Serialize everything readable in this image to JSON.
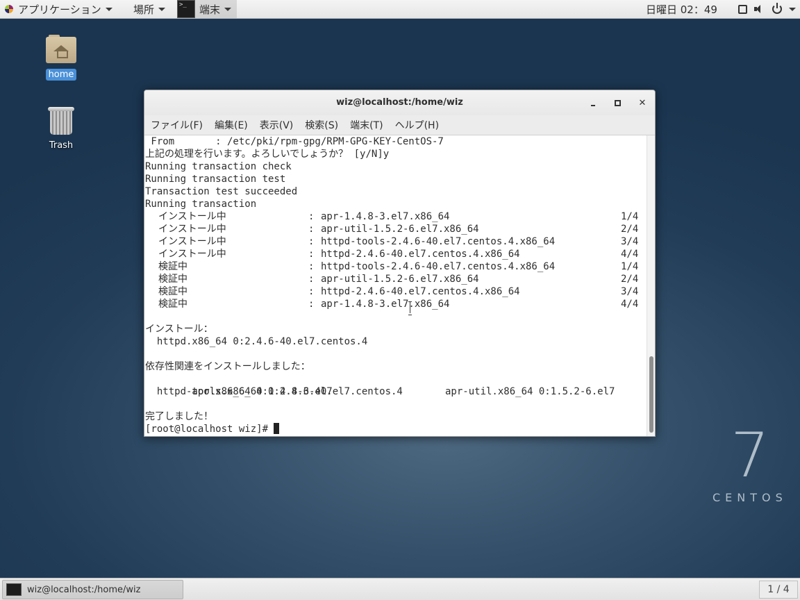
{
  "top_panel": {
    "applications": "アプリケーション",
    "places": "場所",
    "active_app": "端末",
    "clock": "日曜日 02：49"
  },
  "desktop": {
    "icons": [
      {
        "label": "home",
        "icon": "home-folder-icon"
      },
      {
        "label": "Trash",
        "icon": "trash-icon"
      }
    ]
  },
  "window": {
    "title": "wiz@localhost:/home/wiz",
    "menu": [
      "ファイル(F)",
      "編集(E)",
      "表示(V)",
      "検索(S)",
      "端末(T)",
      "ヘルプ(H)"
    ],
    "terminal": {
      "header_lines": [
        " From       : /etc/pki/rpm-gpg/RPM-GPG-KEY-CentOS-7",
        "上記の処理を行います。よろしいでしょうか？ [y/N]y",
        "Running transaction check",
        "Running transaction test",
        "Transaction test succeeded",
        "Running transaction"
      ],
      "progress_rows": [
        {
          "action": "インストール中",
          "package": "apr-1.4.8-3.el7.x86_64",
          "count": "1/4"
        },
        {
          "action": "インストール中",
          "package": "apr-util-1.5.2-6.el7.x86_64",
          "count": "2/4"
        },
        {
          "action": "インストール中",
          "package": "httpd-tools-2.4.6-40.el7.centos.4.x86_64",
          "count": "3/4"
        },
        {
          "action": "インストール中",
          "package": "httpd-2.4.6-40.el7.centos.4.x86_64",
          "count": "4/4"
        },
        {
          "action": "検証中",
          "package": "httpd-tools-2.4.6-40.el7.centos.4.x86_64",
          "count": "1/4"
        },
        {
          "action": "検証中",
          "package": "apr-util-1.5.2-6.el7.x86_64",
          "count": "2/4"
        },
        {
          "action": "検証中",
          "package": "httpd-2.4.6-40.el7.centos.4.x86_64",
          "count": "3/4"
        },
        {
          "action": "検証中",
          "package": "apr-1.4.8-3.el7.x86_64",
          "count": "4/4"
        }
      ],
      "installed_header": "インストール：",
      "installed_pkg": "  httpd.x86_64 0:2.4.6-40.el7.centos.4",
      "deps_header": "依存性関連をインストールしました：",
      "deps_line1": "  apr.x86_64 0:1.4.8-3.el7                      apr-util.x86_64 0:1.5.2-6.el7",
      "deps_line2": "  httpd-tools.x86_64 0:2.4.6-40.el7.centos.4",
      "done": "完了しました！",
      "prompt": "[root@localhost wiz]# "
    }
  },
  "branding": {
    "number": "7",
    "name": "CENTOS"
  },
  "bottom_panel": {
    "task": "wiz@localhost:/home/wiz",
    "workspace": "1 / 4"
  }
}
